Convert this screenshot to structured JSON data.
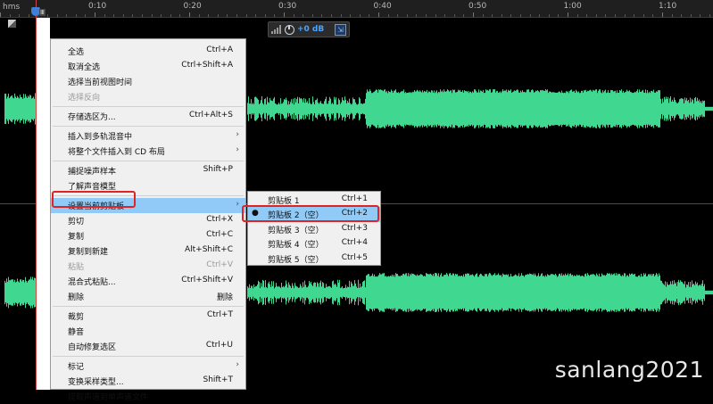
{
  "ruler": {
    "unit": "hms",
    "ticks": [
      "0:10",
      "0:20",
      "0:30",
      "0:40",
      "0:50",
      "1:00",
      "1:10"
    ]
  },
  "hud": {
    "volume": "+0 dB",
    "icons": [
      "level-meter-icon",
      "volume-knob-icon",
      "pin-icon"
    ]
  },
  "colors": {
    "waveform": "#40d890",
    "highlight": "#91c9f7",
    "annotation": "#e02424",
    "playhead": "#d64646"
  },
  "menu": {
    "groups": [
      [
        {
          "label": "全选",
          "shortcut": "Ctrl+A"
        },
        {
          "label": "取消全选",
          "shortcut": "Ctrl+Shift+A"
        },
        {
          "label": "选择当前视图时间",
          "shortcut": ""
        },
        {
          "label": "选择反向",
          "shortcut": "",
          "disabled": true
        }
      ],
      [
        {
          "label": "存储选区为...",
          "shortcut": "Ctrl+Alt+S"
        }
      ],
      [
        {
          "label": "插入到多轨混音中",
          "shortcut": "",
          "submenu": true
        },
        {
          "label": "将整个文件插入到 CD 布局",
          "shortcut": "",
          "submenu": true
        }
      ],
      [
        {
          "label": "捕捉噪声样本",
          "shortcut": "Shift+P"
        },
        {
          "label": "了解声音模型",
          "shortcut": ""
        }
      ],
      [
        {
          "label": "设置当前剪贴板",
          "shortcut": "",
          "submenu": true,
          "highlighted": true
        },
        {
          "label": "剪切",
          "shortcut": "Ctrl+X"
        },
        {
          "label": "复制",
          "shortcut": "Ctrl+C"
        },
        {
          "label": "复制到新建",
          "shortcut": "Alt+Shift+C"
        },
        {
          "label": "粘贴",
          "shortcut": "Ctrl+V",
          "disabled": true
        },
        {
          "label": "混合式粘贴...",
          "shortcut": "Ctrl+Shift+V"
        },
        {
          "label": "删除",
          "shortcut": "删除"
        }
      ],
      [
        {
          "label": "裁剪",
          "shortcut": "Ctrl+T"
        },
        {
          "label": "静音",
          "shortcut": ""
        },
        {
          "label": "自动修复选区",
          "shortcut": "Ctrl+U"
        }
      ],
      [
        {
          "label": "标记",
          "shortcut": "",
          "submenu": true
        },
        {
          "label": "变换采样类型...",
          "shortcut": "Shift+T"
        },
        {
          "label": "提取声道到单声道文件",
          "shortcut": ""
        }
      ]
    ]
  },
  "submenu": {
    "items": [
      {
        "label": "剪贴板 1",
        "shortcut": "Ctrl+1"
      },
      {
        "label": "剪贴板 2（空）",
        "shortcut": "Ctrl+2",
        "selected": true,
        "highlighted": true
      },
      {
        "label": "剪贴板 3（空）",
        "shortcut": "Ctrl+3"
      },
      {
        "label": "剪贴板 4（空）",
        "shortcut": "Ctrl+4"
      },
      {
        "label": "剪贴板 5（空）",
        "shortcut": "Ctrl+5"
      }
    ],
    "bullet": "●"
  },
  "watermark": "sanlang2021"
}
